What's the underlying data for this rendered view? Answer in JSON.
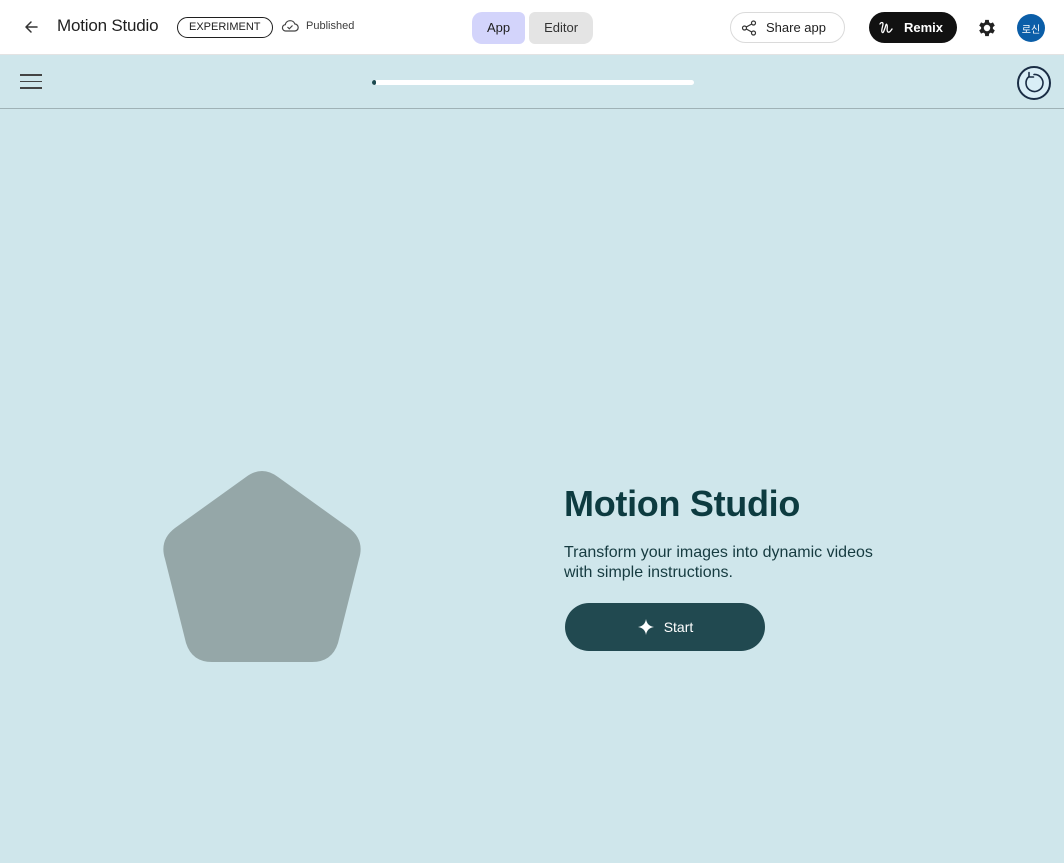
{
  "header": {
    "title": "Motion Studio",
    "badge": "EXPERIMENT",
    "status": "Published",
    "tabs": [
      {
        "label": "App",
        "active": true
      },
      {
        "label": "Editor",
        "active": false
      }
    ],
    "share_label": "Share app",
    "remix_label": "Remix",
    "avatar_initials": "로신"
  },
  "subbar": {
    "progress_percent": 1
  },
  "hero": {
    "title": "Motion Studio",
    "subtitle": "Transform your images into dynamic videos with simple instructions.",
    "start_label": "Start"
  },
  "colors": {
    "background": "#cfe6eb",
    "accent": "#214950",
    "shape": "#95a7a8"
  },
  "icons": [
    "back-arrow-icon",
    "cloud-icon",
    "share-icon",
    "remix-icon",
    "gear-icon",
    "menu-icon",
    "reset-icon",
    "sparkle-icon"
  ]
}
